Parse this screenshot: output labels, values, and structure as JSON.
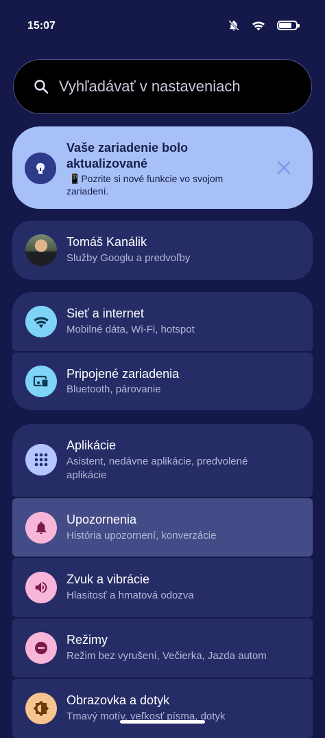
{
  "status": {
    "time": "15:07"
  },
  "search": {
    "placeholder": "Vyhľadávať v nastaveniach"
  },
  "update_card": {
    "title": "Vaše zariadenie bolo aktualizované",
    "subtitle": "📲 Pozrite si nové funkcie vo svojom zariadení."
  },
  "account": {
    "name": "Tomáš Kanálik",
    "subtitle": "Služby Googlu a predvoľby"
  },
  "items": [
    {
      "title": "Sieť a internet",
      "subtitle": "Mobilné dáta, Wi‑Fi, hotspot",
      "icon": "wifi-icon",
      "color": "#7fd3f7"
    },
    {
      "title": "Pripojené zariadenia",
      "subtitle": "Bluetooth, párovanie",
      "icon": "devices-icon",
      "color": "#7fd3f7"
    },
    {
      "title": "Aplikácie",
      "subtitle": "Asistent, nedávne aplikácie, predvolené aplikácie",
      "icon": "apps-icon",
      "color": "#b4c5ff"
    },
    {
      "title": "Upozornenia",
      "subtitle": "História upozornení, konverzácie",
      "icon": "bell-icon",
      "color": "#f7b6d8"
    },
    {
      "title": "Zvuk a vibrácie",
      "subtitle": "Hlasitosť a hmatová odozva",
      "icon": "speaker-icon",
      "color": "#f7b6d8"
    },
    {
      "title": "Režimy",
      "subtitle": "Režim bez vyrušení, Večierka, Jazda autom",
      "icon": "do-not-disturb-icon",
      "color": "#f7b6d8"
    },
    {
      "title": "Obrazovka a dotyk",
      "subtitle": "Tmavý motív, veľkosť písma, dotyk",
      "icon": "brightness-icon",
      "color": "#f6c48e"
    }
  ]
}
